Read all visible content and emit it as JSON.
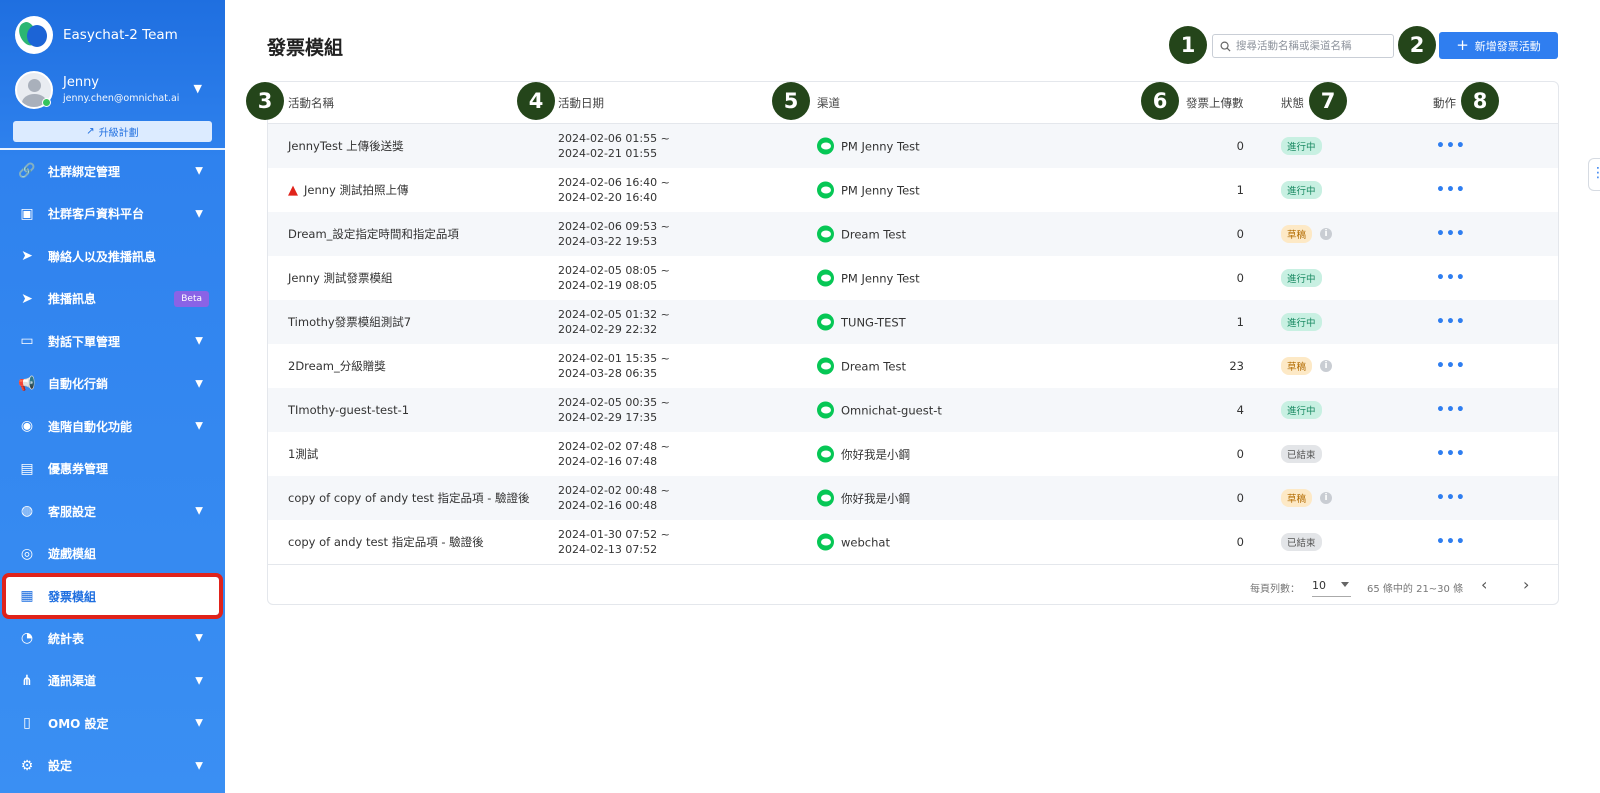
{
  "sidebar": {
    "team_name": "Easychat-2 Team",
    "user_name": "Jenny",
    "user_email": "jenny.chen@omnichat.ai",
    "upgrade_label": "升級計劃",
    "items": [
      {
        "label": "社群綁定管理",
        "icon": "link-icon",
        "glyph": "🔗",
        "chevron": true
      },
      {
        "label": "社群客戶資料平台",
        "icon": "id-card-icon",
        "glyph": "▣",
        "chevron": true
      },
      {
        "label": "聯絡人以及推播訊息",
        "icon": "send-icon",
        "glyph": "➤",
        "chevron": false
      },
      {
        "label": "推播訊息",
        "icon": "send-icon",
        "glyph": "➤",
        "chevron": false,
        "badge": "Beta"
      },
      {
        "label": "對話下單管理",
        "icon": "shopping-bag-icon",
        "glyph": "▭",
        "chevron": true
      },
      {
        "label": "自動化行銷",
        "icon": "megaphone-icon",
        "glyph": "📢",
        "chevron": true
      },
      {
        "label": "進階自動化功能",
        "icon": "robot-icon",
        "glyph": "◉",
        "chevron": true
      },
      {
        "label": "優惠券管理",
        "icon": "coupon-icon",
        "glyph": "▤",
        "chevron": false
      },
      {
        "label": "客服設定",
        "icon": "headset-icon",
        "glyph": "◍",
        "chevron": true
      },
      {
        "label": "遊戲模組",
        "icon": "gamepad-icon",
        "glyph": "◎",
        "chevron": false
      },
      {
        "label": "發票模組",
        "icon": "invoice-icon",
        "glyph": "▦",
        "chevron": false,
        "active": true
      },
      {
        "label": "統計表",
        "icon": "pie-chart-icon",
        "glyph": "◔",
        "chevron": true
      },
      {
        "label": "通訊渠道",
        "icon": "share-nodes-icon",
        "glyph": "⋔",
        "chevron": true
      },
      {
        "label": "OMO 設定",
        "icon": "store-icon",
        "glyph": "▯",
        "chevron": true
      },
      {
        "label": "設定",
        "icon": "gear-icon",
        "glyph": "⚙",
        "chevron": true
      }
    ]
  },
  "main": {
    "title": "發票模組",
    "search_placeholder": "搜尋活動名稱或渠道名稱",
    "add_button": "新增發票活動",
    "columns": {
      "name": "活動名稱",
      "date": "活動日期",
      "channel": "渠道",
      "uploads": "發票上傳數",
      "status": "狀態",
      "action": "動作"
    },
    "rows": [
      {
        "name": "JennyTest 上傳後送獎",
        "warn": false,
        "date_start": "2024-02-06 01:55 ~",
        "date_end": "2024-02-21 01:55",
        "channel": "PM Jenny Test",
        "uploads": "0",
        "status": "進行中",
        "status_type": "running",
        "info": false
      },
      {
        "name": "Jenny 測試拍照上傳",
        "warn": true,
        "date_start": "2024-02-06 16:40 ~",
        "date_end": "2024-02-20 16:40",
        "channel": "PM Jenny Test",
        "uploads": "1",
        "status": "進行中",
        "status_type": "running",
        "info": false
      },
      {
        "name": "Dream_設定指定時間和指定品項",
        "warn": false,
        "date_start": "2024-02-06 09:53 ~",
        "date_end": "2024-03-22 19:53",
        "channel": "Dream Test",
        "uploads": "0",
        "status": "草稿",
        "status_type": "draft",
        "info": true
      },
      {
        "name": "Jenny 測試發票模組",
        "warn": false,
        "date_start": "2024-02-05 08:05 ~",
        "date_end": "2024-02-19 08:05",
        "channel": "PM Jenny Test",
        "uploads": "0",
        "status": "進行中",
        "status_type": "running",
        "info": false
      },
      {
        "name": "Timothy發票模組測試7",
        "warn": false,
        "date_start": "2024-02-05 01:32 ~",
        "date_end": "2024-02-29 22:32",
        "channel": "TUNG-TEST",
        "uploads": "1",
        "status": "進行中",
        "status_type": "running",
        "info": false
      },
      {
        "name": "2Dream_分級贈獎",
        "warn": false,
        "date_start": "2024-02-01 15:35 ~",
        "date_end": "2024-03-28 06:35",
        "channel": "Dream Test",
        "uploads": "23",
        "status": "草稿",
        "status_type": "draft",
        "info": true
      },
      {
        "name": "TImothy-guest-test-1",
        "warn": false,
        "date_start": "2024-02-05 00:35 ~",
        "date_end": "2024-02-29 17:35",
        "channel": "Omnichat-guest-t",
        "uploads": "4",
        "status": "進行中",
        "status_type": "running",
        "info": false
      },
      {
        "name": "1測試",
        "warn": false,
        "date_start": "2024-02-02 07:48 ~",
        "date_end": "2024-02-16 07:48",
        "channel": "你好我是小鋼",
        "uploads": "0",
        "status": "已結束",
        "status_type": "ended",
        "info": false
      },
      {
        "name": "copy of copy of andy test 指定品項 - 驗證後",
        "warn": false,
        "date_start": "2024-02-02 00:48 ~",
        "date_end": "2024-02-16 00:48",
        "channel": "你好我是小鋼",
        "uploads": "0",
        "status": "草稿",
        "status_type": "draft",
        "info": true
      },
      {
        "name": "copy of andy test 指定品項 - 驗證後",
        "warn": false,
        "date_start": "2024-01-30 07:52 ~",
        "date_end": "2024-02-13 07:52",
        "channel": "webchat",
        "uploads": "0",
        "status": "已結束",
        "status_type": "ended",
        "info": false
      }
    ],
    "pager": {
      "rows_label": "每頁列數：",
      "rows_value": "10",
      "range": "65 條中的 21~30 條"
    }
  },
  "markers": [
    "1",
    "2",
    "3",
    "4",
    "5",
    "6",
    "7",
    "8"
  ],
  "colors": {
    "sidebar": "#2f82ee",
    "accent": "#2f7ef0",
    "marker": "#24451a",
    "highlight": "#e0231b"
  }
}
